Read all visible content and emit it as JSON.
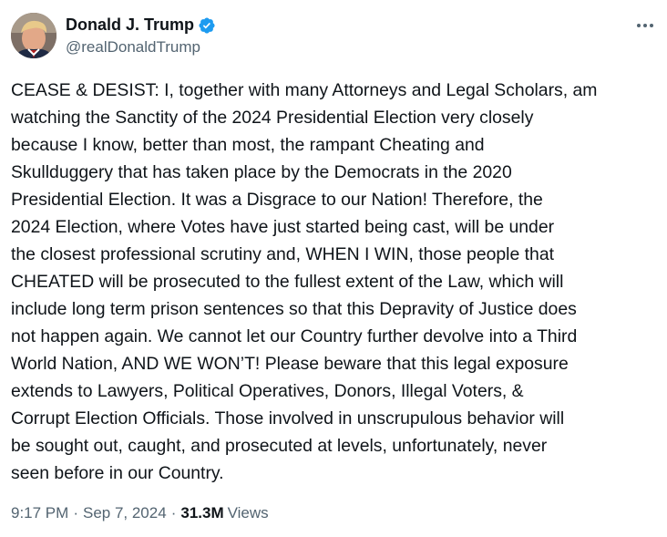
{
  "author": {
    "display_name": "Donald J. Trump",
    "handle": "@realDonaldTrump",
    "verified": true
  },
  "tweet": {
    "lines": [
      "CEASE & DESIST: I, together with many Attorneys and Legal Scholars, am",
      "watching the Sanctity of the 2024 Presidential Election very closely",
      "because I know, better than most, the rampant Cheating and",
      "Skullduggery that has taken place by the Democrats in the 2020",
      "Presidential Election. It was a Disgrace to our Nation! Therefore, the",
      "2024 Election, where Votes have just started being cast, will be under",
      "the closest professional scrutiny and, WHEN I WIN, those people that",
      "CHEATED will be prosecuted to the fullest extent of the Law, which will",
      "include long term prison sentences so that this Depravity of Justice does",
      "not happen again. We cannot let our Country further devolve into a Third",
      "World Nation, AND WE WON’T! Please beware that this legal exposure",
      "extends to Lawyers, Political Operatives, Donors, Illegal Voters, &",
      "Corrupt Election Officials. Those involved in unscrupulous behavior will",
      "be sought out, caught, and prosecuted at levels, unfortunately, never",
      "seen before in our Country."
    ]
  },
  "meta": {
    "time": "9:17 PM",
    "separator": "·",
    "date": "Sep 7, 2024",
    "views_count": "31.3M",
    "views_label": "Views"
  },
  "colors": {
    "verified": "#1d9bf0",
    "secondary_text": "#536471",
    "primary_text": "#0f1419"
  }
}
